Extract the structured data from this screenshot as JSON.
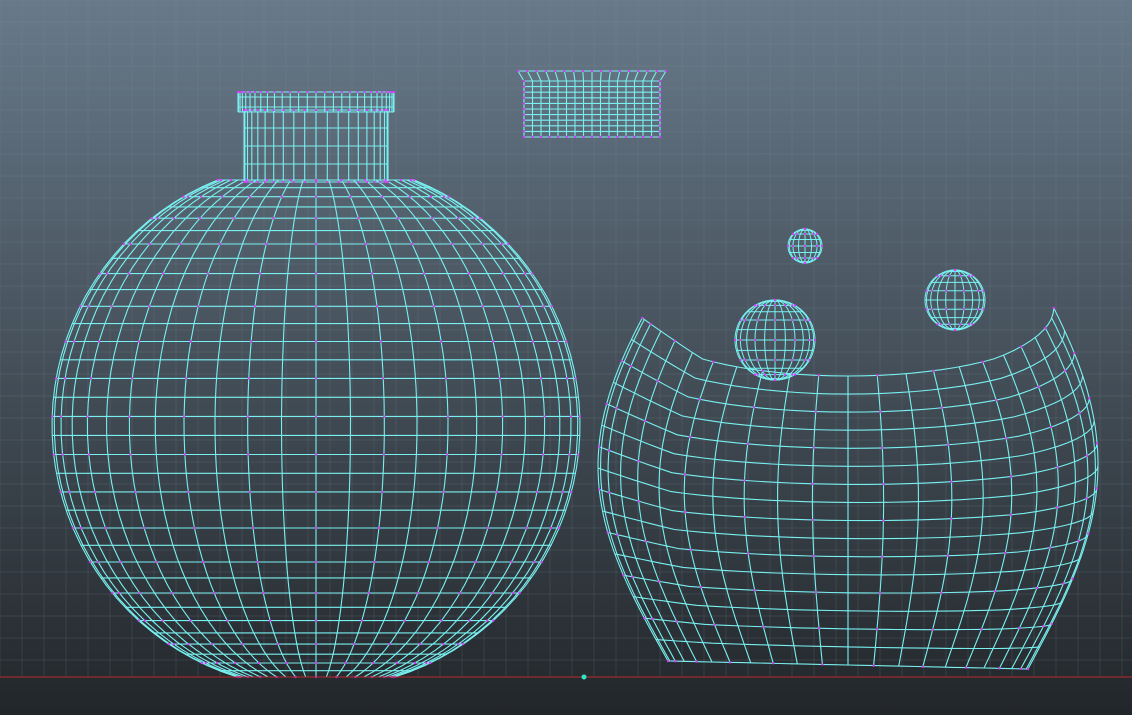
{
  "viewport": {
    "view": "front",
    "background_top": "#687a8a",
    "background_bottom": "#22262a",
    "grid_color": "#7e8e9c",
    "ground_line_color": "#b82a2a",
    "origin_marker_color": "#2ee6c8",
    "wire_color": "#79f0f0",
    "vertex_color": "#d63cff",
    "display_mode": "wireframe",
    "components": "vertices"
  },
  "objects": [
    {
      "name": "bottle-body",
      "type": "sphere-bottle"
    },
    {
      "name": "bottle-neck",
      "type": "cylinder"
    },
    {
      "name": "bottle-cap",
      "type": "cylinder"
    },
    {
      "name": "deformed-bowl",
      "type": "deformed-sphere"
    },
    {
      "name": "small-sphere-1",
      "type": "sphere"
    },
    {
      "name": "small-sphere-2",
      "type": "sphere"
    },
    {
      "name": "small-sphere-3",
      "type": "sphere"
    }
  ]
}
